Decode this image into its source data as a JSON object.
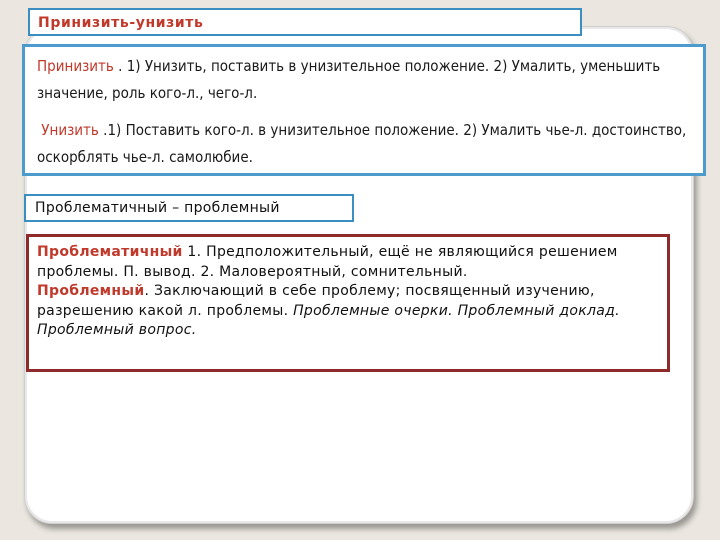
{
  "heading1": "Принизить-унизить",
  "block1": {
    "term1": "Принизить",
    "text1": " . 1) Унизить, поставить в унизительное положение. 2) Умалить, уменьшить значение, роль кого-л., чего-л.",
    "term2": "Унизить",
    "text2": " .1) Поставить кого-л. в унизительное положение. 2) Умалить чье-л. достоинство, оскорблять чье-л. самолюбие."
  },
  "heading2": "Проблематичный – проблемный",
  "block2": {
    "term1": "Проблематичный",
    "text1": " 1. Предположительный, ещё не являющийся решением проблемы. П. вывод. 2. Маловероятный, сомнительный.",
    "term2": "Проблемный",
    "text2": ". Заключающий в себе проблему; посвященный изучению, разрешению какой л. проблемы. ",
    "example": "Проблемные очерки. Проблемный доклад. Проблемный вопрос."
  },
  "colors": {
    "accent_red": "#c0392b",
    "border_blue": "#3b8ec2",
    "border_dark_red": "#8e2a2a",
    "background": "#ebe7e0"
  }
}
